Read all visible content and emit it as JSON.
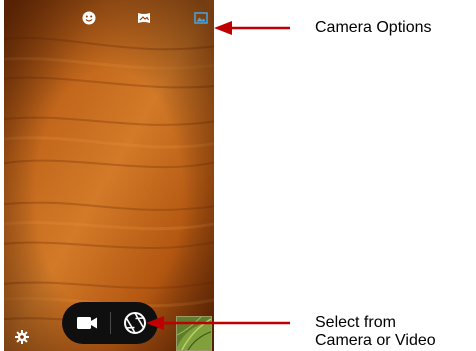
{
  "camera": {
    "top_icons": [
      {
        "icon": "smiley-face-icon"
      },
      {
        "icon": "panorama-icon"
      },
      {
        "icon": "image-gallery-icon"
      }
    ],
    "bottom": {
      "settings_icon": "gear-icon",
      "video_icon": "video-camera-icon",
      "shutter_icon": "camera-shutter-icon",
      "thumbnail": "last-photo-thumbnail"
    }
  },
  "annotations": {
    "camera_options_label": "Camera Options",
    "select_from_line1": "Select from",
    "select_from_line2": "Camera or Video"
  },
  "colors": {
    "arrow": "#c00000",
    "wood": "#b65a10",
    "pill": "#0f0f0f",
    "icon": "#ffffff",
    "gallery_icon": "#4aa3df"
  }
}
